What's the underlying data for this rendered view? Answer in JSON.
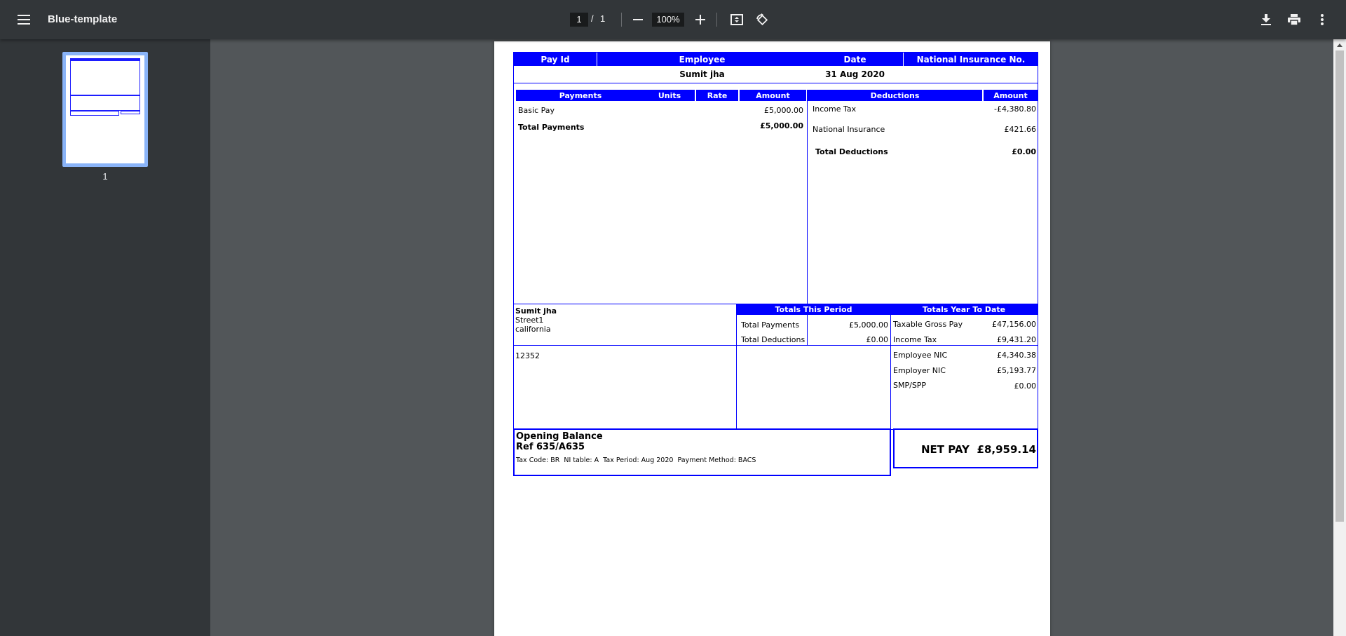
{
  "viewer": {
    "title": "Blue-template",
    "current_page": "1",
    "page_separator": "/",
    "total_pages": "1",
    "zoom": "100%",
    "thumbnail_label": "1",
    "icons": [
      "menu-icon",
      "zoom-out-icon",
      "zoom-in-icon",
      "fit-page-icon",
      "rotate-icon",
      "download-icon",
      "print-icon",
      "more-icon"
    ]
  },
  "payslip": {
    "header": {
      "labels": [
        "Pay Id",
        "Employee",
        "Date",
        "National Insurance No."
      ],
      "values": {
        "pay_id": "",
        "employee": "Sumit jha",
        "date": "31 Aug 2020",
        "ni_number": ""
      }
    },
    "payments": {
      "headers": [
        "Payments",
        "Units",
        "Rate",
        "Amount"
      ],
      "rows": [
        {
          "label": "Basic Pay",
          "amount": "£5,000.00"
        }
      ],
      "total_label": "Total Payments",
      "total_amount": "£5,000.00"
    },
    "deductions": {
      "headers": [
        "Deductions",
        "Amount"
      ],
      "rows": [
        {
          "label": "Income Tax",
          "amount": "-£4,380.80"
        },
        {
          "label": "National Insurance",
          "amount": "£421.66"
        }
      ],
      "total_label": "Total Deductions",
      "total_amount": "£0.00"
    },
    "address": {
      "name": "Sumit jha",
      "line1": "Street1",
      "line2": "california",
      "postcode": "12352"
    },
    "totals_period": {
      "header": "Totals This Period",
      "rows": [
        {
          "label": "Total Payments",
          "amount": "£5,000.00"
        },
        {
          "label": "Total Deductions",
          "amount": "£0.00"
        }
      ]
    },
    "totals_ytd": {
      "header": "Totals Year To Date",
      "rows": [
        {
          "label": "Taxable Gross Pay",
          "amount": "£47,156.00"
        },
        {
          "label": "Income Tax",
          "amount": "£9,431.20"
        },
        {
          "label": "Employee NIC",
          "amount": "£4,340.38"
        },
        {
          "label": "Employer NIC",
          "amount": "£5,193.77"
        },
        {
          "label": "SMP/SPP",
          "amount": "£0.00"
        }
      ]
    },
    "footer": {
      "opening_balance": "Opening Balance",
      "ref": "Ref 635/A635",
      "tax_info": "Tax Code: BR  NI table: A  Tax Period: Aug 2020  Payment Method: BACS",
      "net_pay_label": "NET PAY",
      "net_pay_amount": "£8,959.14"
    }
  },
  "colors": {
    "accent": "#0000ff",
    "toolbar": "#323639",
    "viewer_bg": "#525659"
  }
}
